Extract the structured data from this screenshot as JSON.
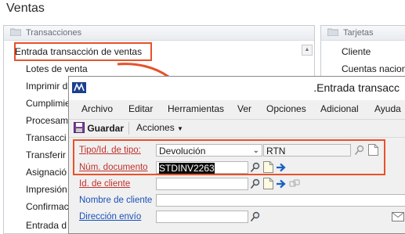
{
  "page": {
    "title": "Ventas"
  },
  "left_panel": {
    "header": "Transacciones",
    "items": [
      "Entrada transacción de ventas",
      "Lotes de venta",
      "Imprimir d",
      "Cumplimie",
      "Procesam",
      "Transacci",
      "Transferir",
      "Asignació",
      "Impresión",
      "Confirmac",
      "Entrada d"
    ]
  },
  "right_panel": {
    "header": "Tarjetas",
    "items": [
      "Cliente",
      "Cuentas naciona"
    ]
  },
  "dialog": {
    "title": ".Entrada transacc",
    "menu": [
      "Archivo",
      "Editar",
      "Herramientas",
      "Ver",
      "Opciones",
      "Adicional",
      "Ayuda"
    ],
    "toolbar": {
      "save_label": "Guardar",
      "actions_label": "Acciones"
    },
    "form": {
      "type_label": "Tipo/Id. de tipo:",
      "type_value": "Devolución",
      "type_id_value": "RTN",
      "doc_label": "Núm. documento",
      "doc_value": "STDINV2263",
      "customer_id_label": "Id. de cliente",
      "customer_name_label": "Nombre de cliente",
      "shipping_label": "Dirección envío"
    }
  },
  "colors": {
    "annotation": "#e8512a",
    "required_label": "#c0312b",
    "link_label": "#1a4fb8"
  }
}
